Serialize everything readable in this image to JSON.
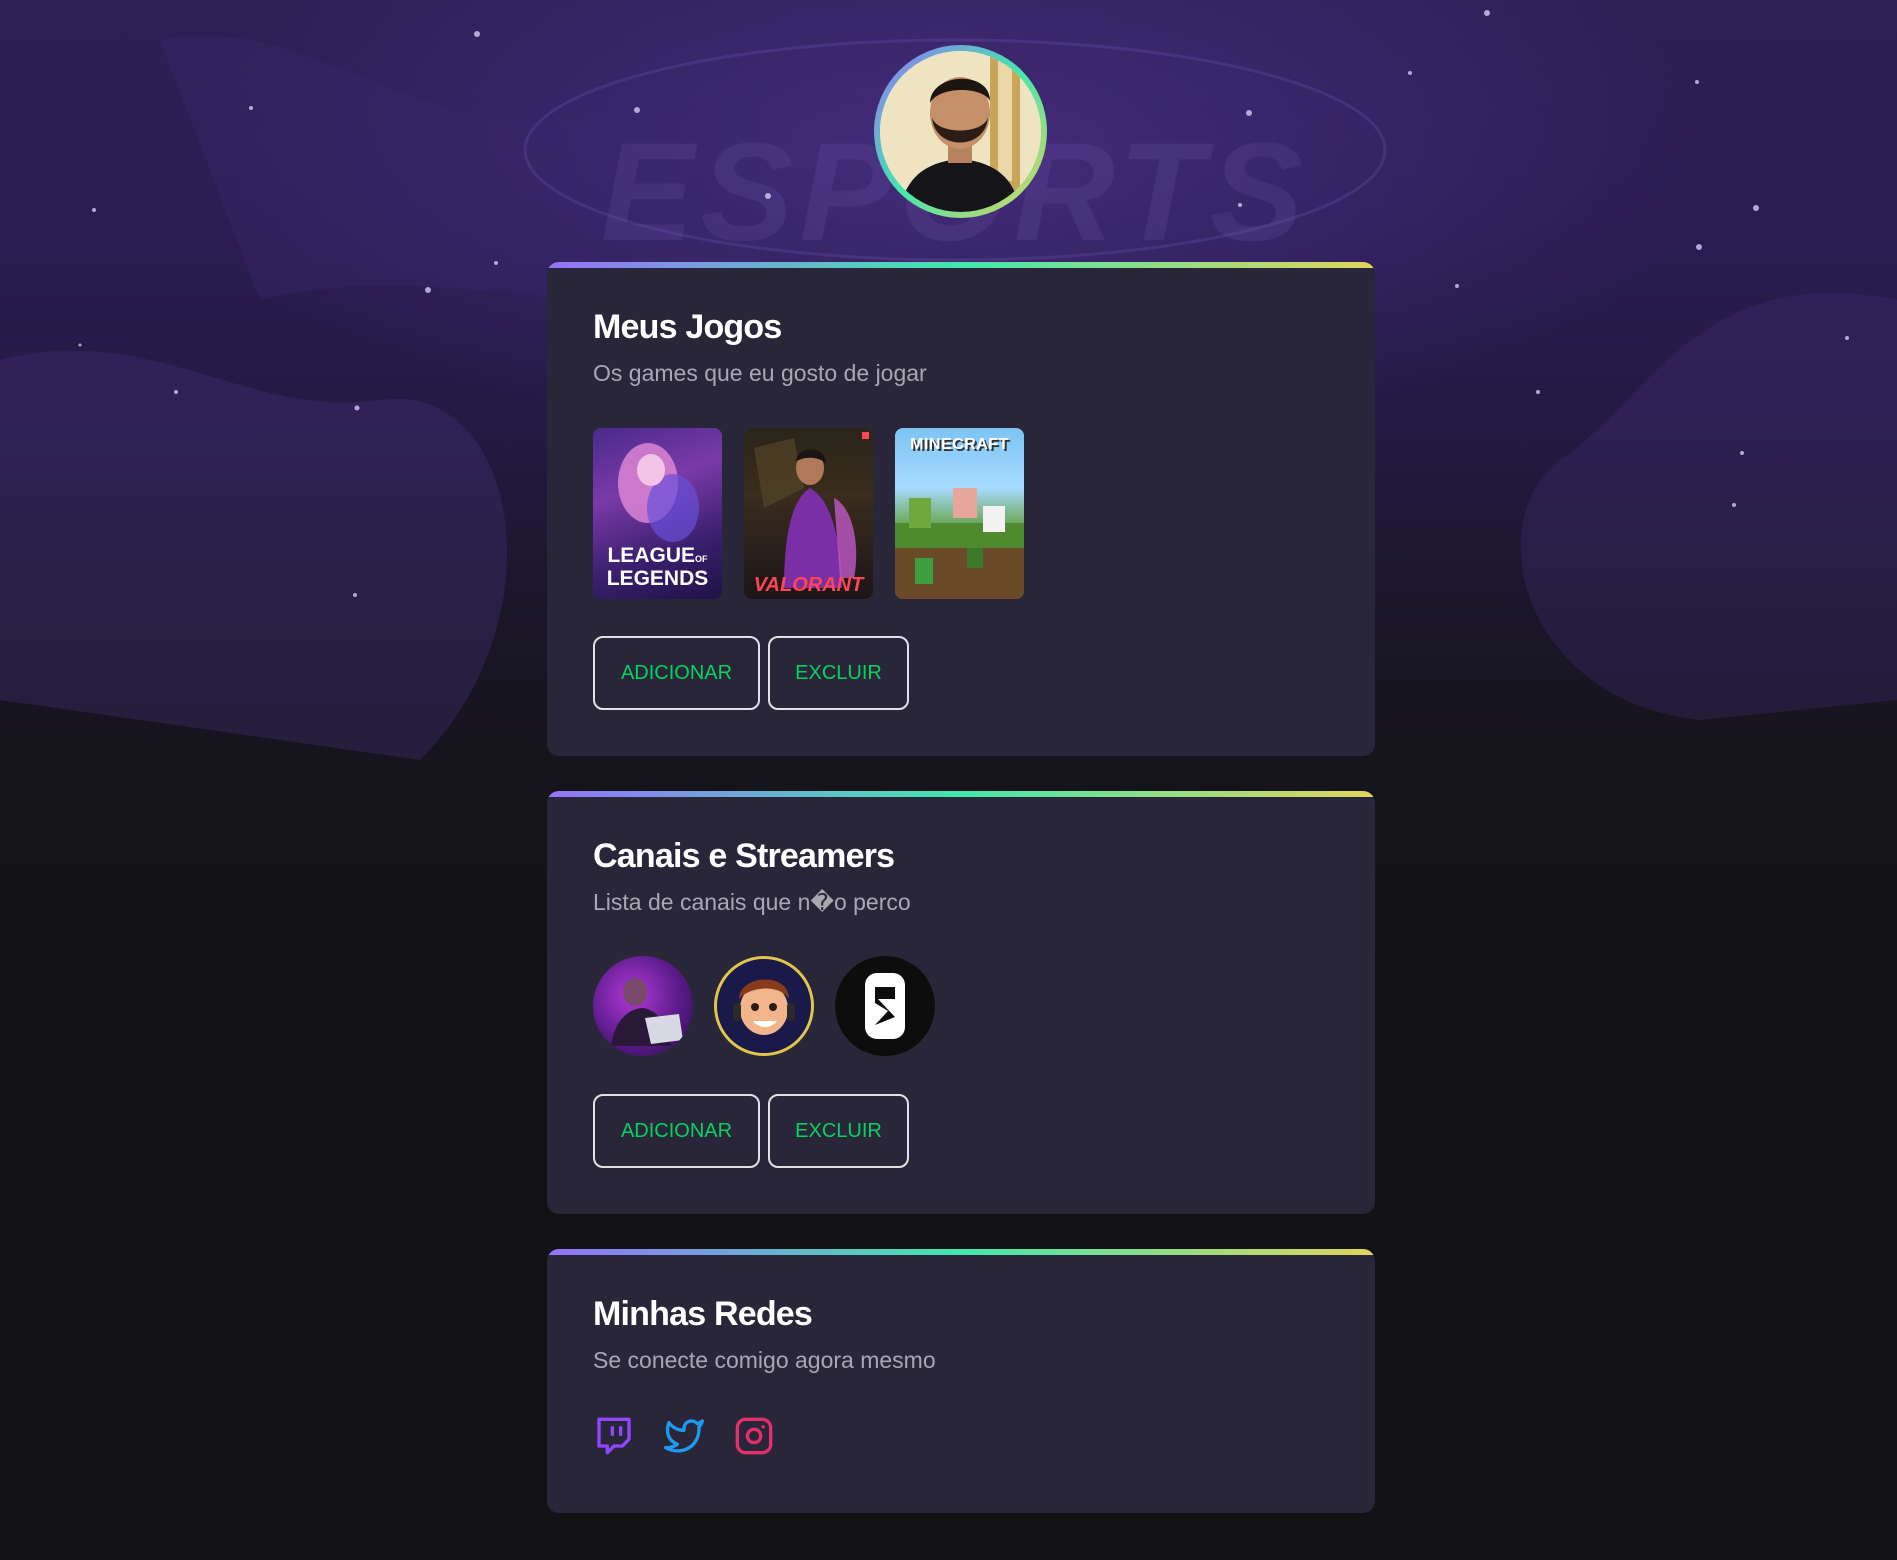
{
  "profile": {
    "avatar_alt": "Foto de perfil"
  },
  "sections": {
    "games": {
      "title": "Meus Jogos",
      "subtitle": "Os games que eu gosto de jogar",
      "items": [
        {
          "name": "League of Legends",
          "logo_line1": "LEAGUE",
          "logo_of": "OF",
          "logo_line2": "LEGENDS"
        },
        {
          "name": "Valorant",
          "logo": "VALORANT"
        },
        {
          "name": "Minecraft",
          "logo": "MINECRAFT"
        }
      ],
      "add_label": "ADICIONAR",
      "delete_label": "EXCLUIR"
    },
    "channels": {
      "title": "Canais e Streamers",
      "subtitle": "Lista de canais que n�o perco",
      "items": [
        {
          "name": "streamer-1"
        },
        {
          "name": "streamer-2"
        },
        {
          "name": "streamer-3"
        }
      ],
      "add_label": "ADICIONAR",
      "delete_label": "EXCLUIR"
    },
    "socials": {
      "title": "Minhas Redes",
      "subtitle": "Se conecte comigo agora mesmo",
      "items": [
        {
          "icon": "twitch-icon",
          "color": "#9147ff"
        },
        {
          "icon": "twitter-icon",
          "color": "#1d9bf0"
        },
        {
          "icon": "instagram-icon",
          "color": "#e1306c"
        }
      ]
    }
  },
  "theme": {
    "accent_gradient": [
      "#9572fc",
      "#43e7ad",
      "#e2d45c"
    ],
    "button_text": "#04d361",
    "card_bg": "#29263a",
    "page_bg": "#121214"
  }
}
